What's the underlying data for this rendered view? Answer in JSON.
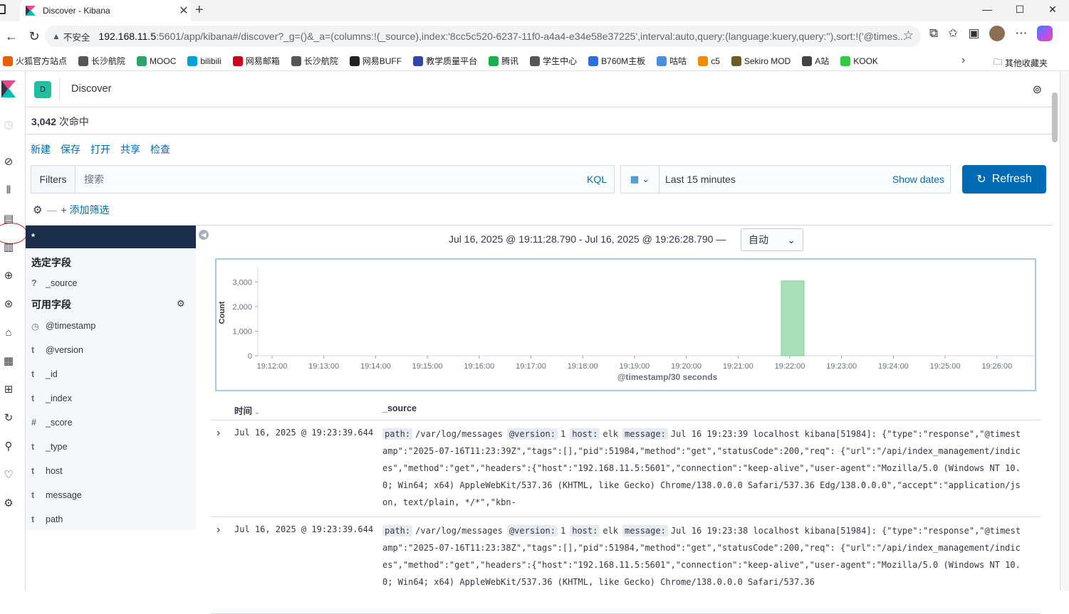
{
  "browser": {
    "tab_title": "Discover - Kibana",
    "insecure_label": "不安全",
    "url_host": "192.168.11.5",
    "url_path": ":5601/app/kibana#/discover?_g=()&_a=(columns:!(_source),index:'8cc5c520-6237-11f0-a4a4-e34e58e37225',interval:auto,query:(language:kuery,query:''),sort:!('@times...",
    "window_buttons": [
      "—",
      "☐",
      "✕"
    ]
  },
  "bookmarks": [
    {
      "label": "火狐官方站点",
      "color": "#e66000"
    },
    {
      "label": "长沙航院",
      "color": "#555555"
    },
    {
      "label": "MOOC",
      "color": "#2aa66a"
    },
    {
      "label": "bilibili",
      "color": "#00a1d6"
    },
    {
      "label": "网易邮箱",
      "color": "#d0021b"
    },
    {
      "label": "长沙航院",
      "color": "#555555"
    },
    {
      "label": "网易BUFF",
      "color": "#222222"
    },
    {
      "label": "教学质量平台",
      "color": "#3344aa"
    },
    {
      "label": "腾讯",
      "color": "#18b24b"
    },
    {
      "label": "学生中心",
      "color": "#555555"
    },
    {
      "label": "B760M主板",
      "color": "#2a6fdb"
    },
    {
      "label": "咕咕",
      "color": "#4a90e2"
    },
    {
      "label": "c5",
      "color": "#f08c00"
    },
    {
      "label": "Sekiro MOD",
      "color": "#6b5a2a"
    },
    {
      "label": "A站",
      "color": "#444444"
    },
    {
      "label": "KOOK",
      "color": "#2ecc40"
    }
  ],
  "bookmarks_other": "其他收藏夹",
  "kibana": {
    "space_initial": "D",
    "app_title": "Discover",
    "hits_count": "3,042",
    "hits_label": " 次命中",
    "top_nav": [
      "新建",
      "保存",
      "打开",
      "共享",
      "检查"
    ],
    "filters_label": "Filters",
    "search_placeholder": "搜索",
    "kql_label": "KQL",
    "date_range": "Last 15 minutes",
    "show_dates": "Show dates",
    "refresh_label": "Refresh",
    "add_filter": "+ 添加筛选",
    "index_pattern": "*",
    "selected_fields_title": "选定字段",
    "selected_fields": [
      {
        "type": "?",
        "name": "_source"
      }
    ],
    "available_fields_title": "可用字段",
    "available_fields": [
      {
        "type": "◷",
        "name": "@timestamp"
      },
      {
        "type": "t",
        "name": "@version"
      },
      {
        "type": "t",
        "name": "_id"
      },
      {
        "type": "t",
        "name": "_index"
      },
      {
        "type": "#",
        "name": "_score"
      },
      {
        "type": "t",
        "name": "_type"
      },
      {
        "type": "t",
        "name": "host"
      },
      {
        "type": "t",
        "name": "message"
      },
      {
        "type": "t",
        "name": "path"
      }
    ],
    "time_range_text": "Jul 16, 2025 @ 19:11:28.790 - Jul 16, 2025 @ 19:26:28.790 —",
    "interval_value": "自动",
    "table_headers": {
      "time": "时间",
      "source": "_source"
    },
    "rows": [
      {
        "time": "Jul 16, 2025 @ 19:23:39.644",
        "path": "/var/log/messages",
        "version": "1",
        "host": "elk",
        "message": "Jul 16 19:23:39 localhost kibana[51984]: {\"type\":\"response\",\"@timestamp\":\"2025-07-16T11:23:39Z\",\"tags\":[],\"pid\":51984,\"method\":\"get\",\"statusCode\":200,\"req\": {\"url\":\"/api/index_management/indices\",\"method\":\"get\",\"headers\":{\"host\":\"192.168.11.5:5601\",\"connection\":\"keep-alive\",\"user-agent\":\"Mozilla/5.0 (Windows NT 10.0; Win64; x64) AppleWebKit/537.36 (KHTML, like Gecko) Chrome/138.0.0.0 Safari/537.36 Edg/138.0.0.0\",\"accept\":\"application/json, text/plain, */*\",\"kbn-"
      },
      {
        "time": "Jul 16, 2025 @ 19:23:39.644",
        "path": "/var/log/messages",
        "version": "1",
        "host": "elk",
        "message": "Jul 16 19:23:38 localhost kibana[51984]: {\"type\":\"response\",\"@timestamp\":\"2025-07-16T11:23:38Z\",\"tags\":[],\"pid\":51984,\"method\":\"get\",\"statusCode\":200,\"req\": {\"url\":\"/api/index_management/indices\",\"method\":\"get\",\"headers\":{\"host\":\"192.168.11.5:5601\",\"connection\":\"keep-alive\",\"user-agent\":\"Mozilla/5.0 (Windows NT 10.0; Win64; x64) AppleWebKit/537.36 (KHTML, like Gecko) Chrome/138.0.0.0 Safari/537.36"
      }
    ],
    "source_keys": {
      "path": "path:",
      "version": "@version:",
      "host": "host:",
      "message": "message:"
    }
  },
  "chart_data": {
    "type": "bar",
    "categories": [
      "19:12:00",
      "19:13:00",
      "19:14:00",
      "19:15:00",
      "19:16:00",
      "19:17:00",
      "19:18:00",
      "19:19:00",
      "19:20:00",
      "19:21:00",
      "19:22:00",
      "19:23:00",
      "19:24:00",
      "19:25:00",
      "19:26:00"
    ],
    "bar_x": "19:22:00",
    "values": [
      0,
      0,
      0,
      0,
      0,
      0,
      0,
      0,
      0,
      0,
      3042,
      0,
      0,
      0,
      0
    ],
    "ylabel": "Count",
    "xlabel": "@timestamp/30 seconds",
    "yticks": [
      "0",
      "1,000",
      "2,000",
      "3,000"
    ],
    "ylim": [
      0,
      3500
    ],
    "bar_color": "#a8dfb9"
  }
}
